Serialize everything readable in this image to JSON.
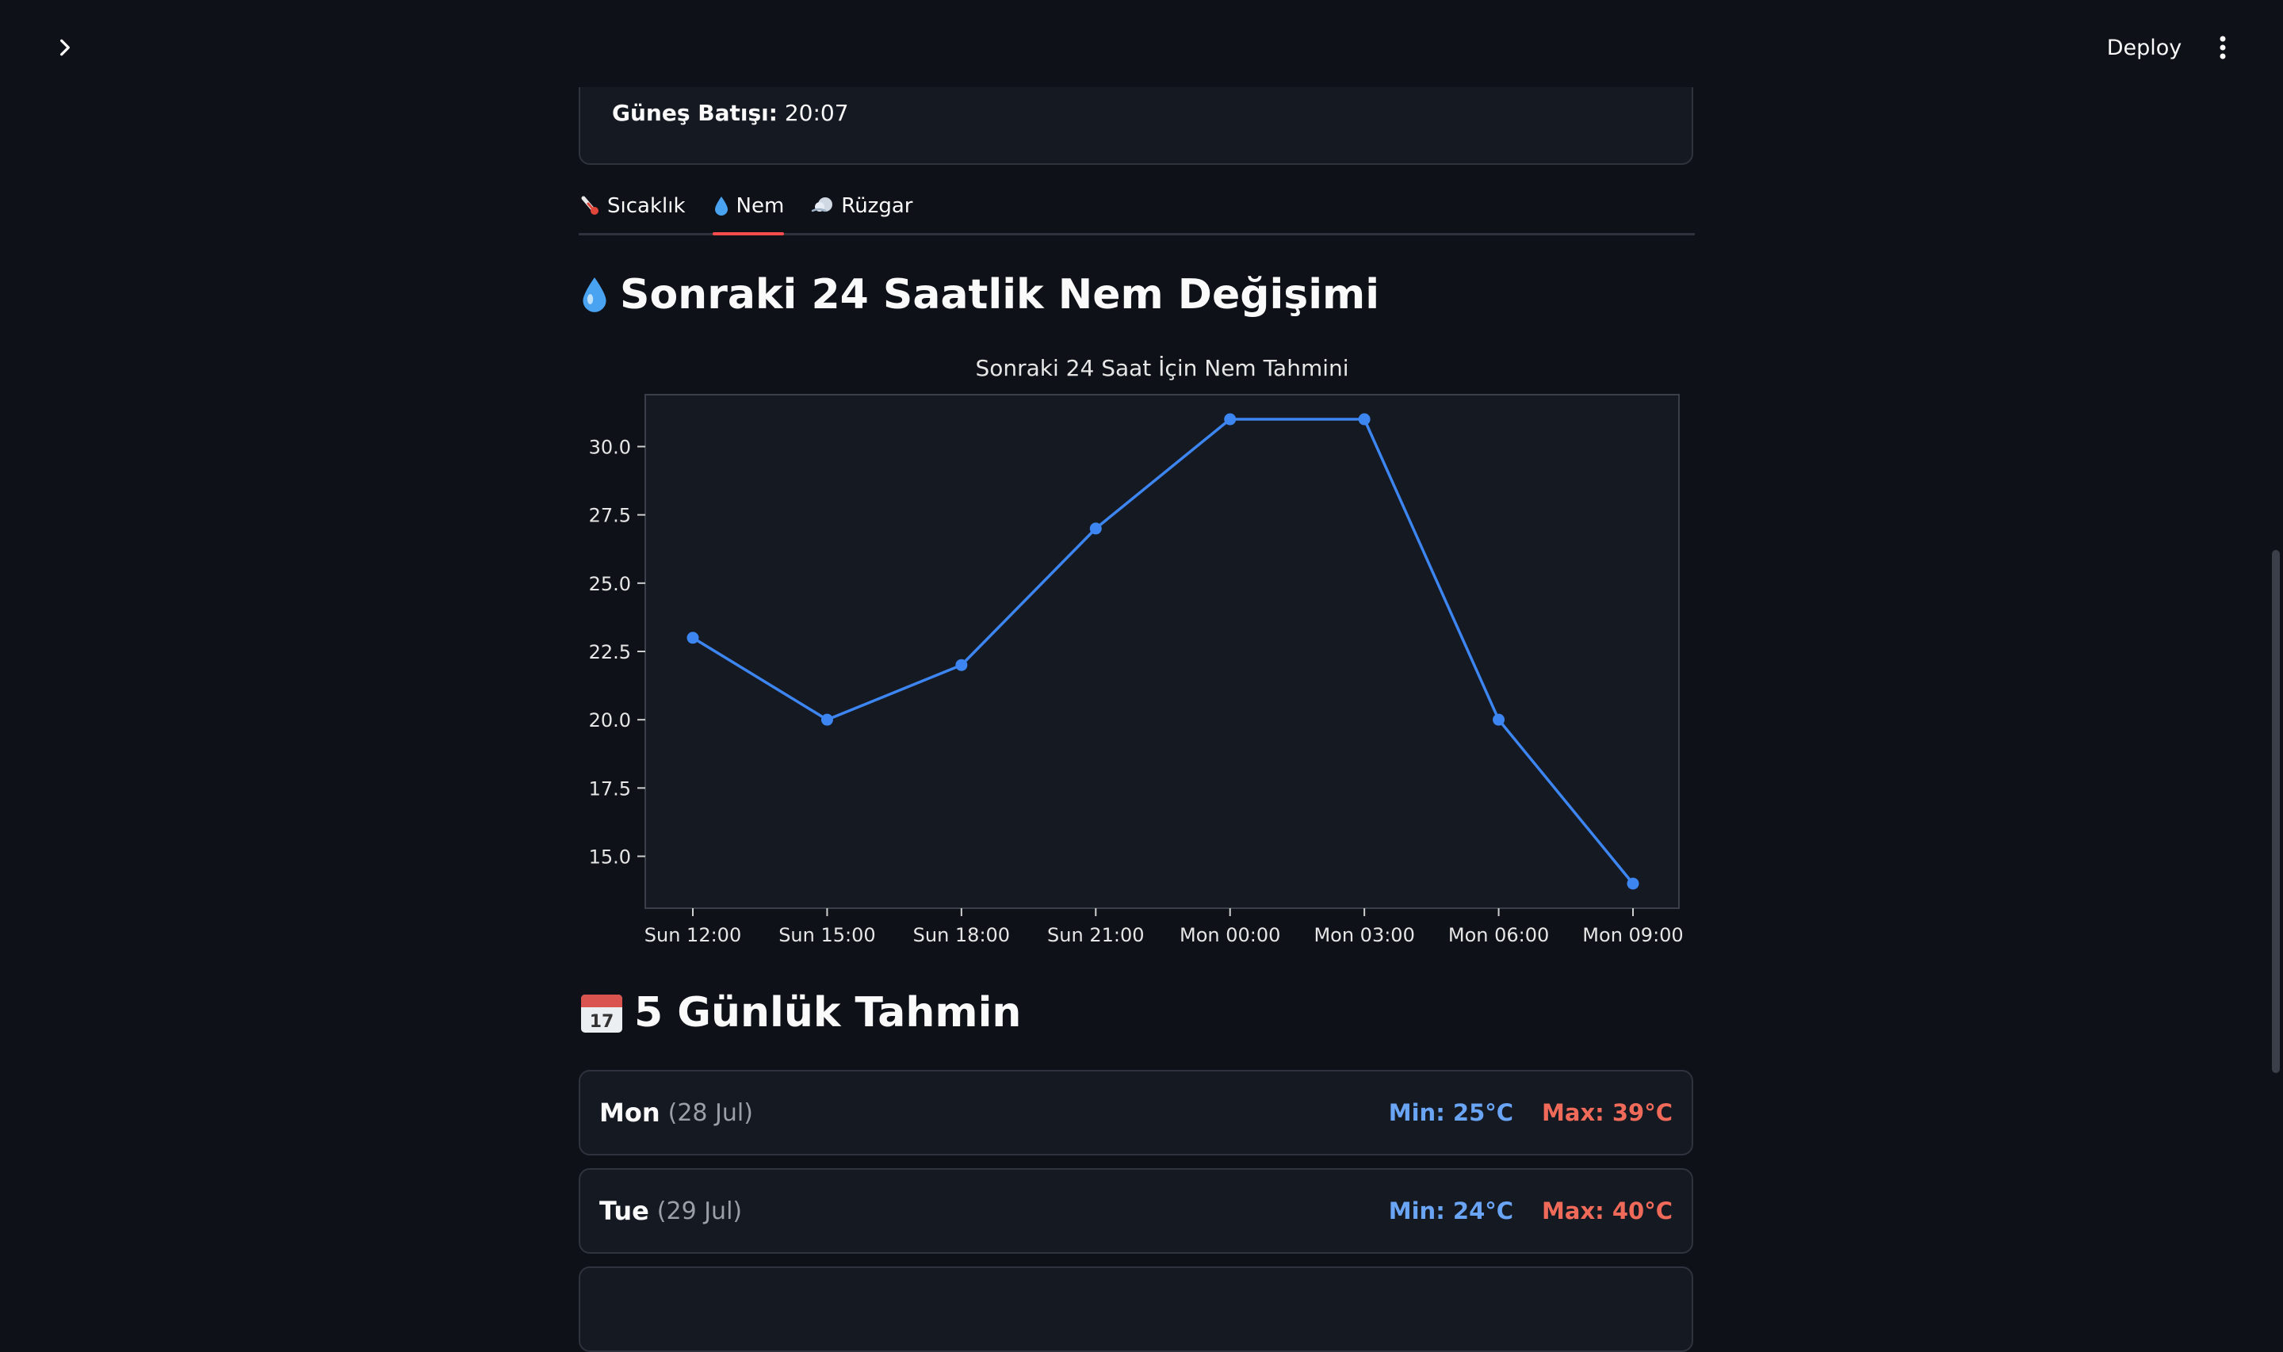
{
  "header": {
    "deploy_label": "Deploy"
  },
  "info_card": {
    "sunset_label": "Güneş Batışı:",
    "sunset_value": "20:07"
  },
  "tabs": [
    {
      "label": "Sıcaklık",
      "icon": "thermometer-icon",
      "active": false
    },
    {
      "label": "Nem",
      "icon": "droplet-icon",
      "active": true
    },
    {
      "label": "Rüzgar",
      "icon": "wind-icon",
      "active": false
    }
  ],
  "humidity_section": {
    "title": "Sonraki 24 Saatlik Nem Değişimi"
  },
  "chart_data": {
    "type": "line",
    "title": "Sonraki 24 Saat İçin Nem Tahmini",
    "xlabel": "",
    "ylabel": "",
    "x": [
      "Sun 12:00",
      "Sun 15:00",
      "Sun 18:00",
      "Sun 21:00",
      "Mon 00:00",
      "Mon 03:00",
      "Mon 06:00",
      "Mon 09:00"
    ],
    "values": [
      23,
      20,
      22,
      27,
      31,
      31,
      20,
      14
    ],
    "y_ticks": [
      "15.0",
      "17.5",
      "20.0",
      "22.5",
      "25.0",
      "27.5",
      "30.0"
    ],
    "ylim": [
      13.1,
      31.9
    ],
    "grid": false,
    "line_color": "#3d85f0",
    "background": "#151922"
  },
  "forecast_section": {
    "title": "5 Günlük Tahmin",
    "days": [
      {
        "day": "Mon",
        "date": "(28 Jul)",
        "min": "Min: 25°C",
        "max": "Max: 39°C"
      },
      {
        "day": "Tue",
        "date": "(29 Jul)",
        "min": "Min: 24°C",
        "max": "Max: 40°C"
      }
    ]
  },
  "colors": {
    "background": "#0e1117",
    "accent": "#ff4b4b",
    "min_temp": "#6aa4f4",
    "max_temp": "#f06a5a"
  }
}
